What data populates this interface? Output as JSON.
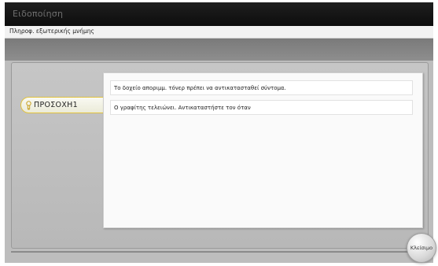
{
  "window": {
    "title": "Ειδοποίηση"
  },
  "subheader": {
    "text": "Πληροφ. εξωτερικής μνήμης"
  },
  "warning": {
    "label": "ΠΡΟΣΟΧΗ1",
    "icon": "lightbulb-icon",
    "accent_color": "#e1c13c"
  },
  "messages": [
    "Το δοχείο αποριμμ. τόνερ πρέπει να αντικατασταθεί σύντομα.",
    "Ο γραφίτης τελειώνει. Αντικαταστήστε τον όταν"
  ],
  "close_button": {
    "label": "Κλείσιμο"
  }
}
